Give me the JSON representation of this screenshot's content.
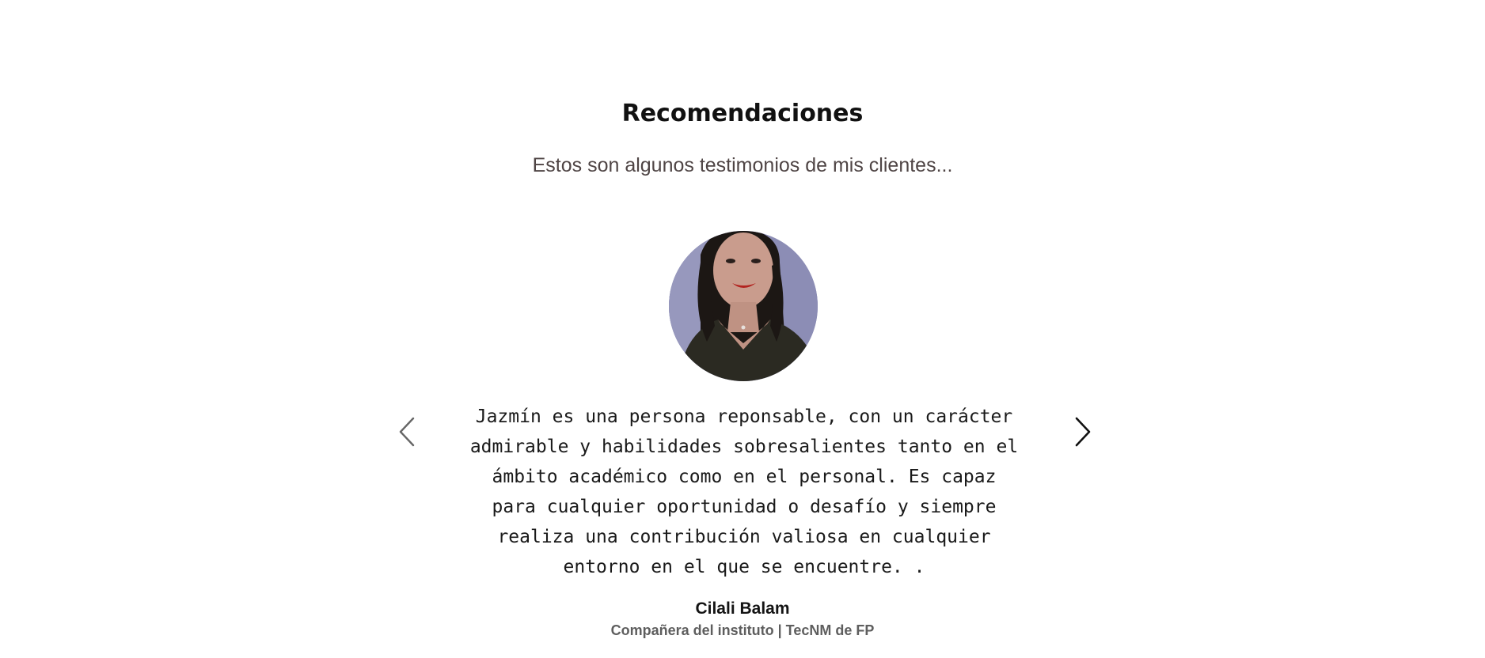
{
  "section": {
    "title": "Recomendaciones",
    "subtitle": "Estos son algunos testimonios de mis clientes..."
  },
  "testimonial": {
    "avatar_icon": "person-photo",
    "quote": "Jazmín es una persona reponsable, con un carácter admirable y habilidades sobresalientes tanto en el ámbito académico como en el personal. Es capaz para cualquier oportunidad o desafío y siempre realiza una contribución valiosa en cualquier entorno en el que se encuentre. .",
    "author_name": "Cilali Balam",
    "author_role": "Compañera del instituto | TecNM de FP"
  },
  "carousel": {
    "prev_icon": "chevron-left-icon",
    "next_icon": "chevron-right-icon"
  },
  "colors": {
    "background": "#ffffff",
    "title": "#111111",
    "subtitle": "#4f4545",
    "avatar_bg": "#8c8db5"
  }
}
